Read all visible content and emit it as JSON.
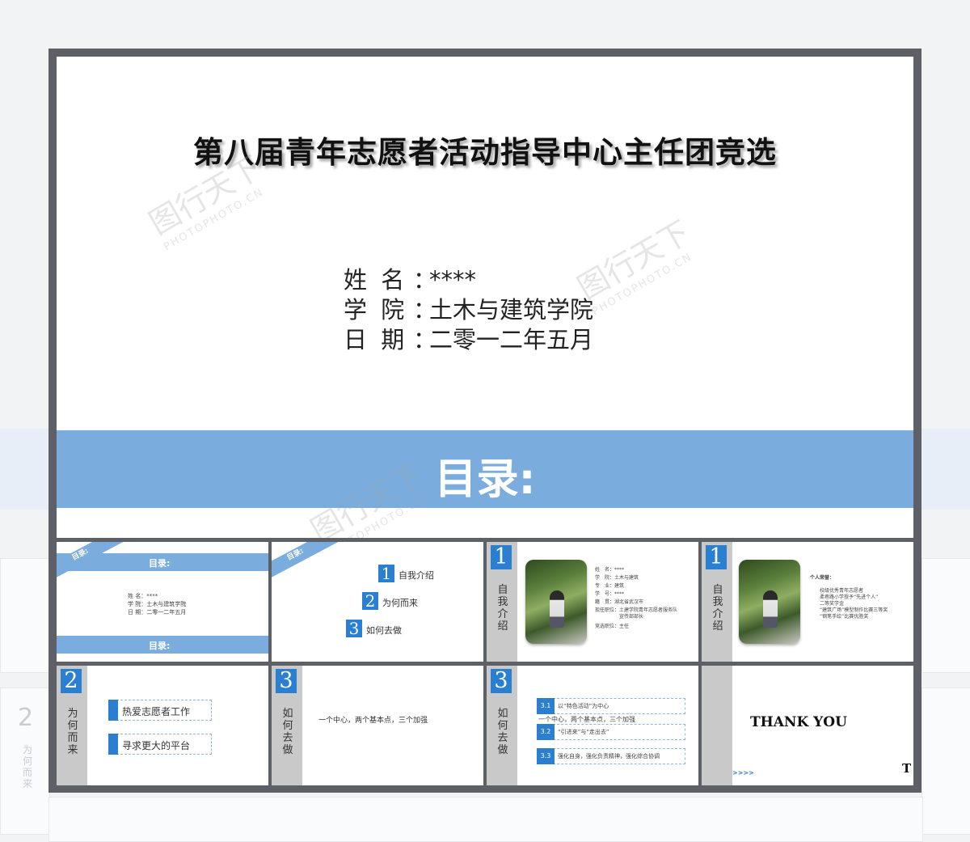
{
  "main": {
    "title": "第八届青年志愿者活动指导中心主任团竞选",
    "name_label": "姓 名",
    "name_value": "****",
    "college_label": "学 院",
    "college_value": "土木与建筑学院",
    "date_label": "日 期",
    "date_value": "二零一二年五月",
    "colon": "：",
    "toc_heading": "目录:"
  },
  "thumb1": {
    "corner": "目录:",
    "top_band": "目录:",
    "line1": "姓 名：****",
    "line2": "学 院：土木与建筑学院",
    "line3": "日 期：二零一二年五月",
    "bottom_band": "目录:"
  },
  "thumb2": {
    "corner": "目录:",
    "items": [
      {
        "num": "1",
        "label": "自我介绍"
      },
      {
        "num": "2",
        "label": "为何而来"
      },
      {
        "num": "3",
        "label": "如何去做"
      }
    ]
  },
  "thumb3": {
    "num": "1",
    "side": "自我介绍",
    "lines": [
      "姓　名：****",
      "学　院：土木与建筑",
      "专　业：建筑",
      "学　号：****",
      "籍　贯：湖北省武汉市",
      "现任职位：土建学院青年志愿者服务队",
      "　　　　　宣传部部长",
      "竞选职位：主任"
    ]
  },
  "thumb4": {
    "num": "1",
    "side": "自我介绍",
    "heading": "个人荣誉：",
    "lines": [
      "校级优秀青年志愿者",
      "柔巷路小学授予“先进个人”",
      "二等奖学金",
      "“建筑广场”模型制作比赛三等奖",
      "“钢笔手绘”比赛优胜奖"
    ]
  },
  "thumb5": {
    "num": "2",
    "side": "为何而来",
    "items": [
      "热爱志愿者工作",
      "寻求更大的平台"
    ]
  },
  "thumb6": {
    "num": "3",
    "side": "如何去做",
    "text": "一个中心，两个基本点，三个加强"
  },
  "thumb7": {
    "num": "3",
    "side": "如何去做",
    "items": [
      {
        "num": "3.1",
        "text": "以“特色活动”为中心"
      },
      {
        "num": "3.2",
        "text": "“引进来”与“走出去”"
      },
      {
        "num": "3.3",
        "text": "强化自身，强化负责精神，强化综合协调"
      }
    ],
    "overlay": "一个中心，两个基本点，三个加强"
  },
  "thumb8": {
    "text": "THANK YOU",
    "arrows": ">>>>",
    "partial": "T"
  },
  "watermark": {
    "brand": "图行天下",
    "url": "PHOTOPHOTO.CN"
  },
  "background": {
    "ghost_side": "为何而来",
    "ghost_num": "2"
  }
}
